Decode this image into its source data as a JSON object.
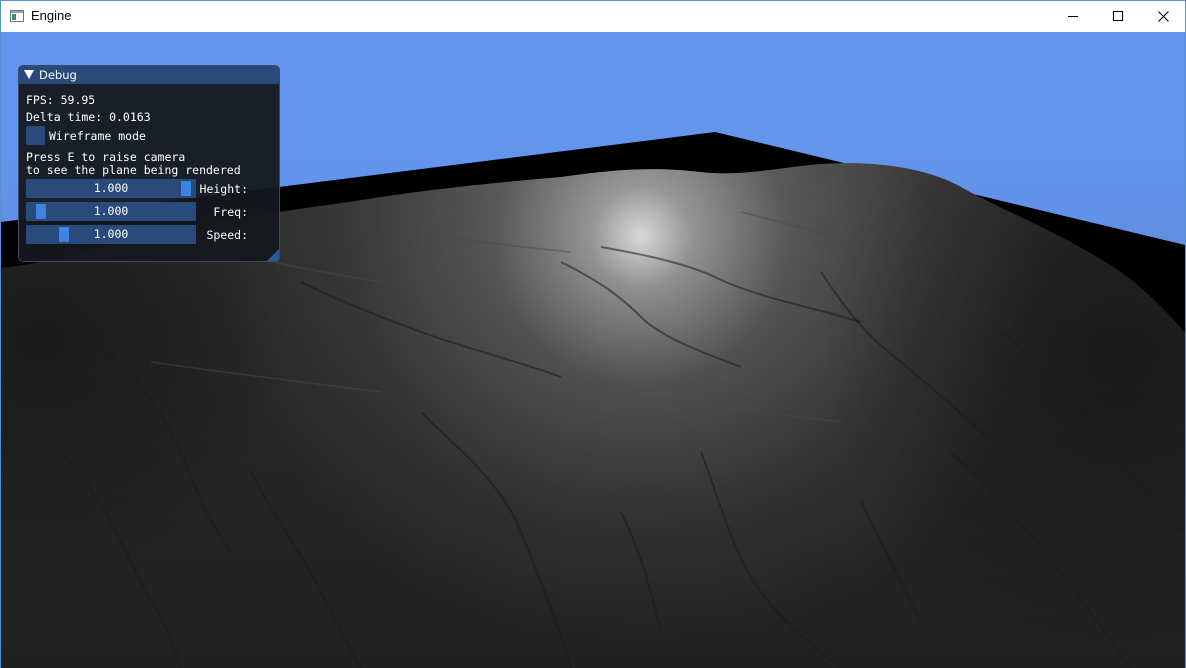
{
  "window": {
    "title": "Engine",
    "icon": "app-window-icon",
    "controls": [
      "minimize-icon",
      "maximize-icon",
      "close-icon"
    ]
  },
  "scene": {
    "sky_color": "#6495ed",
    "ground_color": "#000000",
    "terrain_color": "#3a3a3a",
    "highlight_color": "#d8d8d8"
  },
  "debug": {
    "title": "Debug",
    "fps": "FPS: 59.95",
    "delta_time": "Delta time: 0.0163",
    "wireframe_label": "Wireframe mode",
    "wireframe_checked": false,
    "hint_line1": "Press E to raise camera",
    "hint_line2": "to see the plane being rendered",
    "sliders": [
      {
        "label": "Height:",
        "value": "1.000",
        "fraction": 0.98
      },
      {
        "label": "Freq:",
        "value": "1.000",
        "fraction": 0.05
      },
      {
        "label": "Speed:",
        "value": "1.000",
        "fraction": 0.2
      }
    ],
    "header_color": "#294a7a",
    "accent_color": "#3d85e0"
  }
}
